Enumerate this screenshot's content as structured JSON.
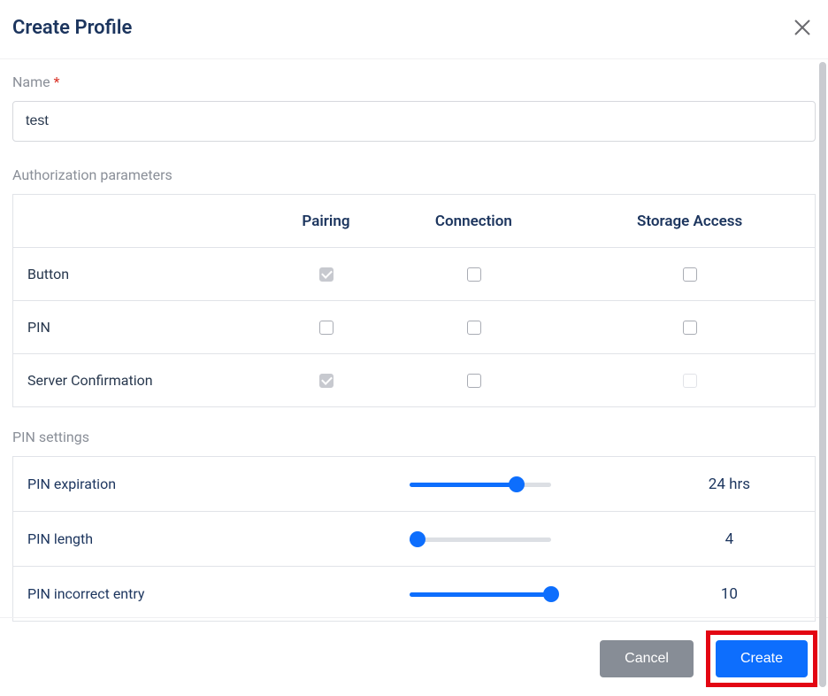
{
  "header": {
    "title": "Create Profile"
  },
  "name_section": {
    "label": "Name",
    "value": "test"
  },
  "auth_section": {
    "label": "Authorization parameters",
    "columns": {
      "pairing": "Pairing",
      "connection": "Connection",
      "storage": "Storage Access"
    },
    "rows": [
      {
        "label": "Button",
        "pairing": {
          "checked": true,
          "disabled": true
        },
        "connection": {
          "checked": false,
          "disabled": false
        },
        "storage": {
          "checked": false,
          "disabled": false
        }
      },
      {
        "label": "PIN",
        "pairing": {
          "checked": false,
          "disabled": false
        },
        "connection": {
          "checked": false,
          "disabled": false
        },
        "storage": {
          "checked": false,
          "disabled": false
        }
      },
      {
        "label": "Server Confirmation",
        "pairing": {
          "checked": true,
          "disabled": true
        },
        "connection": {
          "checked": false,
          "disabled": false
        },
        "storage": {
          "checked": false,
          "disabled": true
        }
      }
    ]
  },
  "pin_section": {
    "label": "PIN settings",
    "rows": [
      {
        "label": "PIN expiration",
        "value_display": "24 hrs",
        "percent": 76
      },
      {
        "label": "PIN length",
        "value_display": "4",
        "percent": 6
      },
      {
        "label": "PIN incorrect entry",
        "value_display": "10",
        "percent": 100
      }
    ]
  },
  "footer": {
    "cancel_label": "Cancel",
    "create_label": "Create"
  }
}
